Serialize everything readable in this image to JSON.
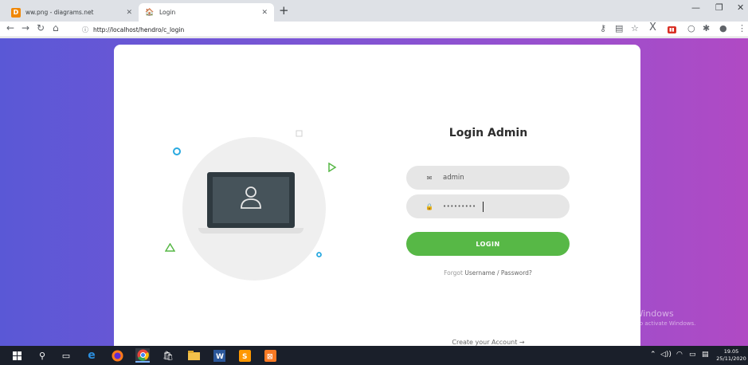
{
  "browser": {
    "tabs": [
      {
        "title": "ww.png - diagrams.net",
        "favicon": "drawio-icon",
        "active": false
      },
      {
        "title": "Login",
        "favicon": "home-icon",
        "active": true
      }
    ],
    "url": "http://localhost/hendro/c_login"
  },
  "login": {
    "title": "Login Admin",
    "username_value": "admin",
    "password_value": "•••••••••",
    "button_label": "LOGIN",
    "forgot_prefix": "Forgot",
    "forgot_link": "Username / Password?",
    "create_account": "Create your Account  →"
  },
  "watermark": {
    "line1": "Activate Windows",
    "line2": "Go to Settings to activate Windows."
  },
  "taskbar": {
    "time": "19.05",
    "date": "25/11/2020"
  },
  "colors": {
    "accent": "#57b846",
    "background_start": "#5a58d6",
    "background_end": "#b04ac4",
    "card": "#ffffff"
  }
}
